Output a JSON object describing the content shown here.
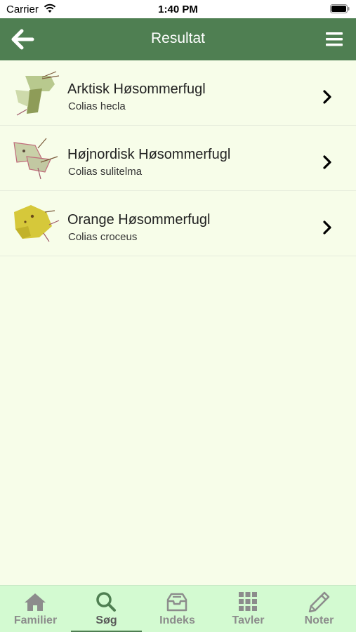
{
  "status_bar": {
    "carrier": "Carrier",
    "time": "1:40 PM"
  },
  "header": {
    "title": "Resultat",
    "back_icon": "arrow-left-icon",
    "menu_icon": "hamburger-menu-icon"
  },
  "results": [
    {
      "name": "Arktisk Høsommerfugl",
      "latin": "Colias hecla",
      "thumb_color": "#b8c98e"
    },
    {
      "name": "Højnordisk Høsommerfugl",
      "latin": "Colias sulitelma",
      "thumb_color": "#c9d0a8"
    },
    {
      "name": "Orange Høsommerfugl",
      "latin": "Colias croceus",
      "thumb_color": "#d6c83a"
    }
  ],
  "tabs": [
    {
      "label": "Familier",
      "icon": "home-icon",
      "active": false
    },
    {
      "label": "Søg",
      "icon": "search-icon",
      "active": true
    },
    {
      "label": "Indeks",
      "icon": "inbox-icon",
      "active": false
    },
    {
      "label": "Tavler",
      "icon": "grid-icon",
      "active": false
    },
    {
      "label": "Noter",
      "icon": "pencil-icon",
      "active": false
    }
  ],
  "colors": {
    "nav": "#4f7f52",
    "background": "#f7fde9",
    "tab_bar": "#d3fad1"
  }
}
